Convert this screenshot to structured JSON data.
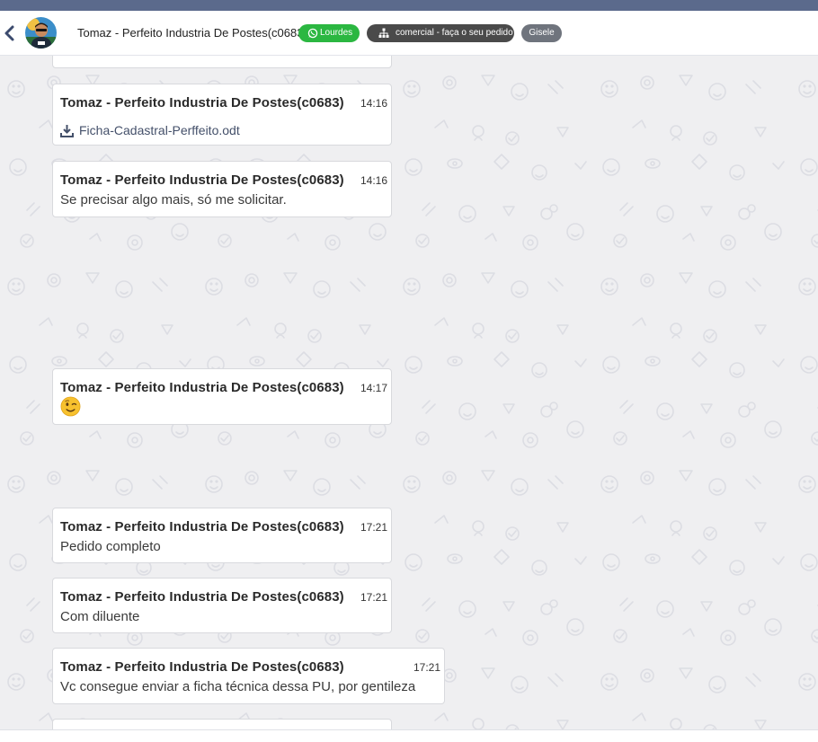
{
  "header": {
    "contact_name": "Tomaz - Perfeito Industria De Postes(c0683)",
    "tags": {
      "whatsapp": "Lourdes",
      "department": "comercial - faça o seu pedido",
      "user": "Gisele"
    }
  },
  "messages": [
    {
      "sender": "Tomaz - Perfeito Industria De Postes(c0683)",
      "time": "14:16",
      "file": "Ficha-Cadastral-Perffeito.odt"
    },
    {
      "sender": "Tomaz - Perfeito Industria De Postes(c0683)",
      "time": "14:16",
      "text": "Se precisar algo mais, só me solicitar."
    },
    {
      "sender": "Tomaz - Perfeito Industria De Postes(c0683)",
      "time": "14:17",
      "emoji": "winking-face"
    },
    {
      "sender": "Tomaz - Perfeito Industria De Postes(c0683)",
      "time": "17:21",
      "text": "Pedido completo"
    },
    {
      "sender": "Tomaz - Perfeito Industria De Postes(c0683)",
      "time": "17:21",
      "text": "Com diluente"
    },
    {
      "sender": "Tomaz - Perfeito Industria De Postes(c0683)",
      "time": "17:21",
      "text": "Vc consegue enviar a ficha técnica dessa PU, por gentileza"
    }
  ],
  "colors": {
    "topbar": "#5b6a8c",
    "whatsapp_tag": "#2bb741",
    "department_tag": "#4a4a4a",
    "user_tag": "#6f747d",
    "chat_background": "#efeff1"
  }
}
